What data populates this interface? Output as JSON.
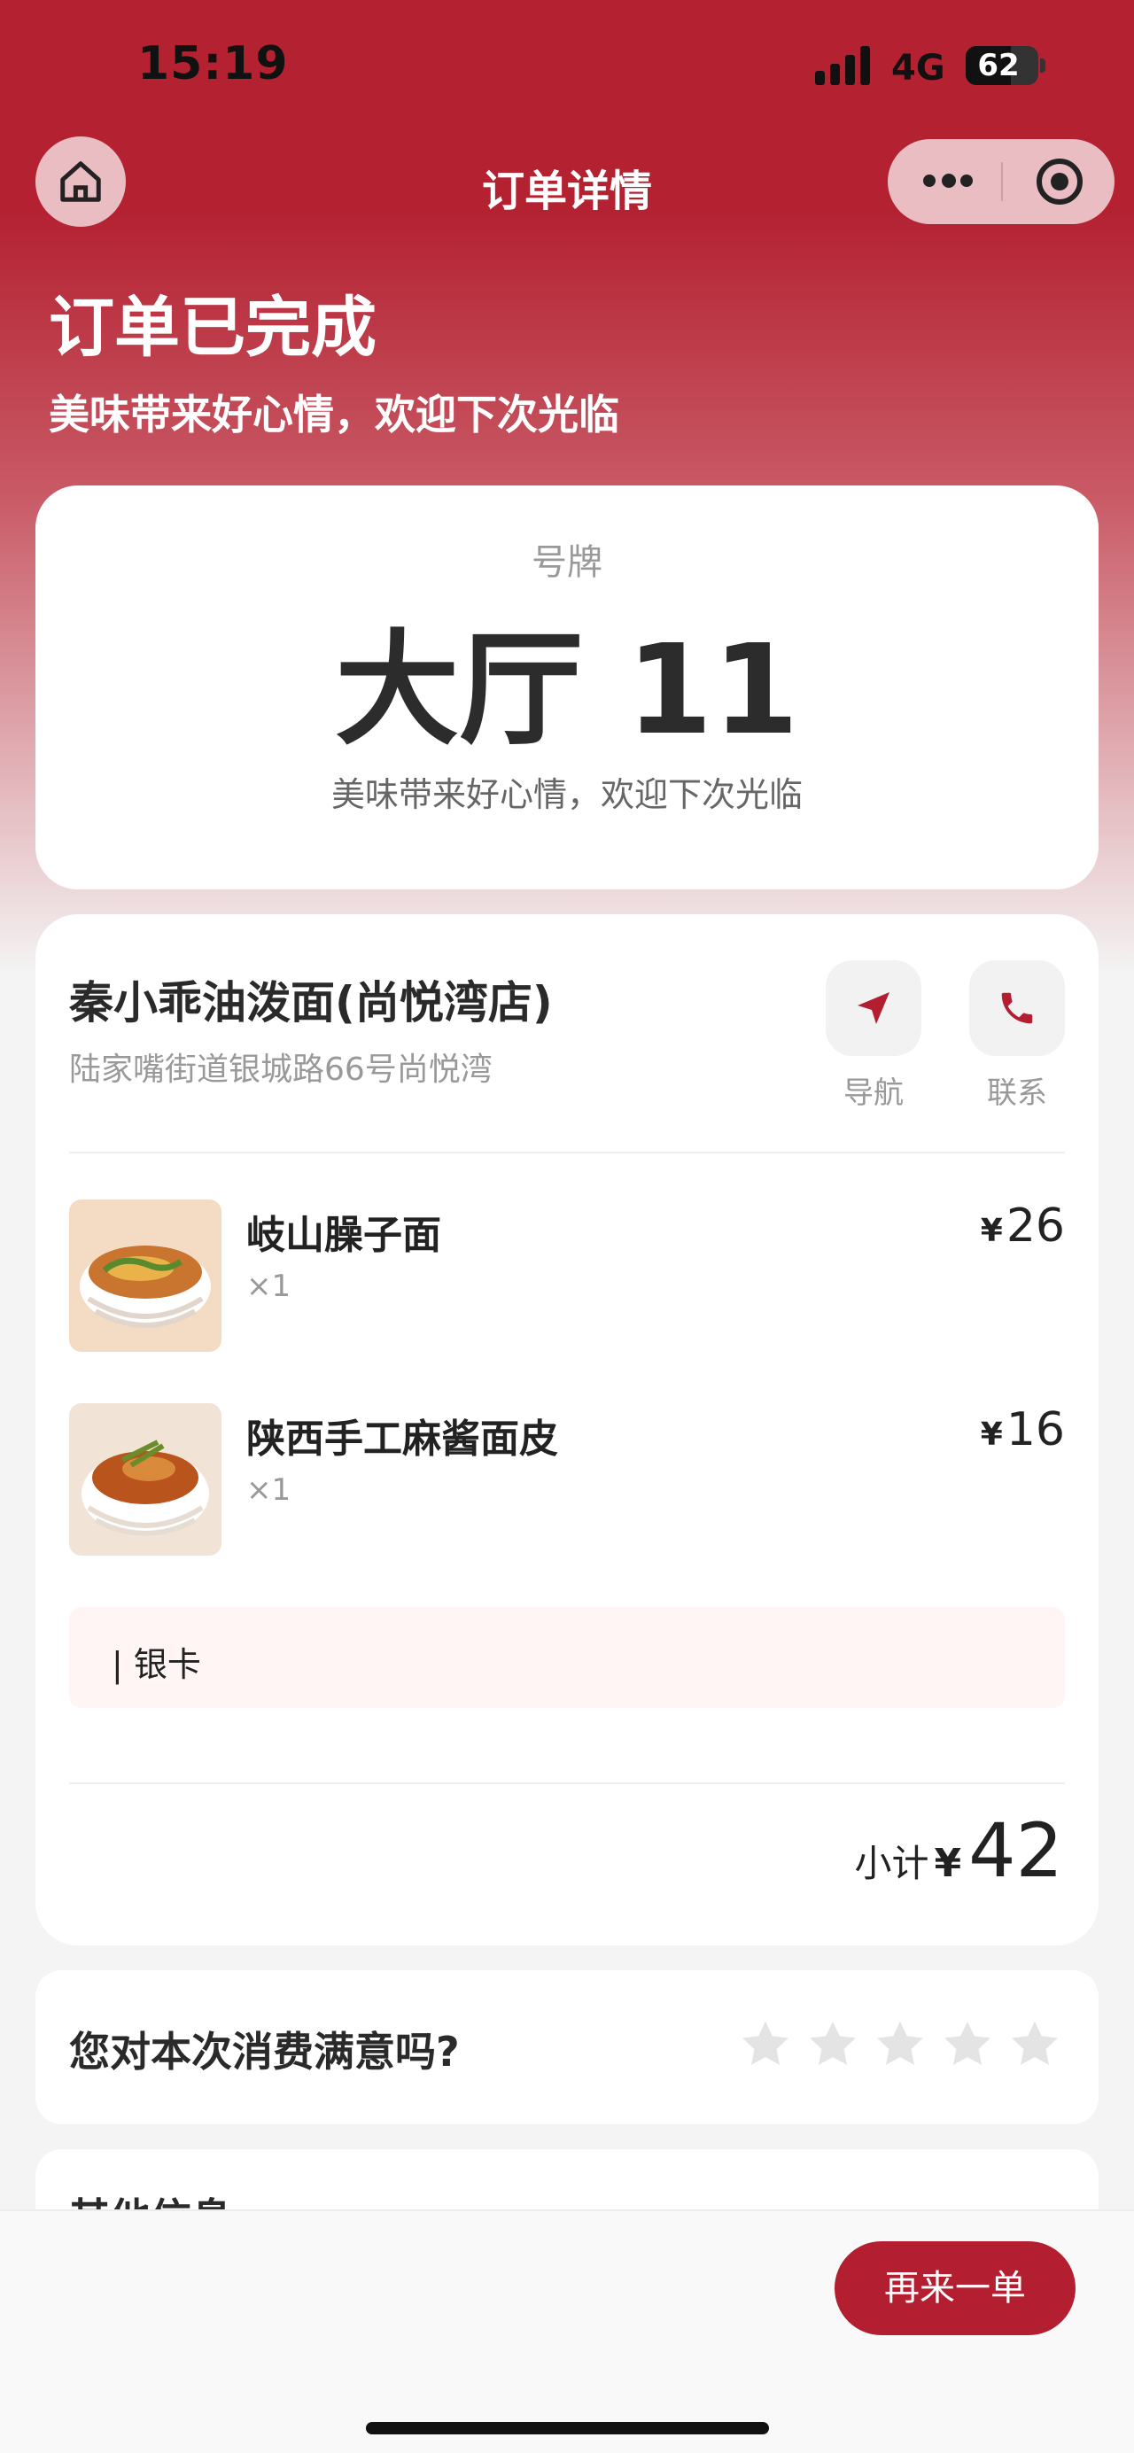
{
  "status_bar": {
    "time": "15:19",
    "network": "4G",
    "battery": "62",
    "battery_level": 0.62
  },
  "nav": {
    "title": "订单详情",
    "home_icon": "home-icon",
    "more_icon": "more-dots-icon",
    "close_icon": "target-circle-icon"
  },
  "header": {
    "status": "订单已完成",
    "subtitle": "美味带来好心情，欢迎下次光临"
  },
  "ticket": {
    "label": "号牌",
    "number": "大厅 11",
    "note": "美味带来好心情，欢迎下次光临"
  },
  "shop": {
    "name": "秦小乖油泼面(尚悦湾店)",
    "address": "陆家嘴街道银城路66号尚悦湾",
    "actions": [
      {
        "label": "导航",
        "icon": "navigation-arrow-icon"
      },
      {
        "label": "联系",
        "icon": "phone-icon"
      }
    ]
  },
  "items": [
    {
      "name": "岐山臊子面",
      "qty": "×1",
      "currency": "¥",
      "price": "26"
    },
    {
      "name": "陕西手工麻酱面皮",
      "qty": "×1",
      "currency": "¥",
      "price": "16"
    }
  ],
  "remark": "| 银卡",
  "subtotal": {
    "label": "小计",
    "currency": "¥",
    "value": "42"
  },
  "rating": {
    "question": "您对本次消费满意吗?",
    "stars": 5,
    "selected": 0
  },
  "other": {
    "title": "其他信息"
  },
  "footer": {
    "reorder_label": "再来一单"
  },
  "colors": {
    "brand": "#b31f31",
    "star_empty": "#e4e4e4"
  }
}
